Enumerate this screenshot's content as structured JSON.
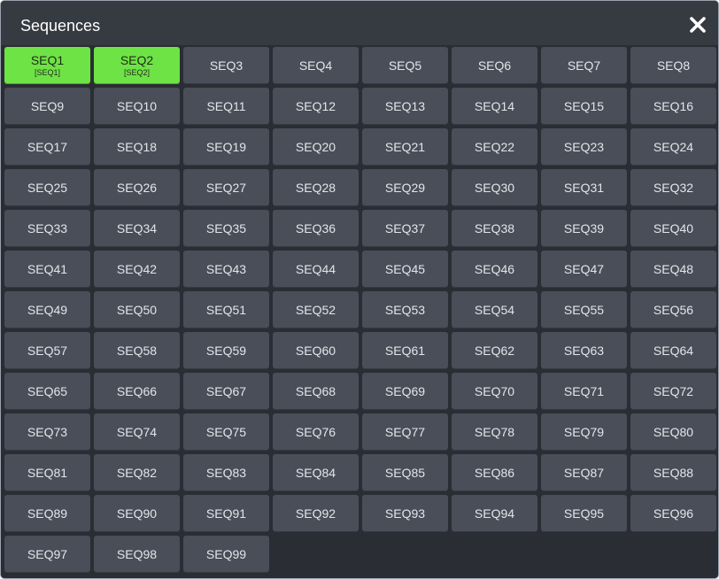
{
  "dialog": {
    "title": "Sequences"
  },
  "close_icon": "close-x-icon",
  "colors": {
    "background": "#2a2d33",
    "titlebar": "#363a41",
    "button": "#4a4e58",
    "active_button": "#6ee346",
    "button_text": "#e3e5ea"
  },
  "sequences": [
    {
      "label": "SEQ1",
      "sub": "[SEQ1]",
      "active": true
    },
    {
      "label": "SEQ2",
      "sub": "[SEQ2]",
      "active": true
    },
    {
      "label": "SEQ3"
    },
    {
      "label": "SEQ4"
    },
    {
      "label": "SEQ5"
    },
    {
      "label": "SEQ6"
    },
    {
      "label": "SEQ7"
    },
    {
      "label": "SEQ8"
    },
    {
      "label": "SEQ9"
    },
    {
      "label": "SEQ10"
    },
    {
      "label": "SEQ11"
    },
    {
      "label": "SEQ12"
    },
    {
      "label": "SEQ13"
    },
    {
      "label": "SEQ14"
    },
    {
      "label": "SEQ15"
    },
    {
      "label": "SEQ16"
    },
    {
      "label": "SEQ17"
    },
    {
      "label": "SEQ18"
    },
    {
      "label": "SEQ19"
    },
    {
      "label": "SEQ20"
    },
    {
      "label": "SEQ21"
    },
    {
      "label": "SEQ22"
    },
    {
      "label": "SEQ23"
    },
    {
      "label": "SEQ24"
    },
    {
      "label": "SEQ25"
    },
    {
      "label": "SEQ26"
    },
    {
      "label": "SEQ27"
    },
    {
      "label": "SEQ28"
    },
    {
      "label": "SEQ29"
    },
    {
      "label": "SEQ30"
    },
    {
      "label": "SEQ31"
    },
    {
      "label": "SEQ32"
    },
    {
      "label": "SEQ33"
    },
    {
      "label": "SEQ34"
    },
    {
      "label": "SEQ35"
    },
    {
      "label": "SEQ36"
    },
    {
      "label": "SEQ37"
    },
    {
      "label": "SEQ38"
    },
    {
      "label": "SEQ39"
    },
    {
      "label": "SEQ40"
    },
    {
      "label": "SEQ41"
    },
    {
      "label": "SEQ42"
    },
    {
      "label": "SEQ43"
    },
    {
      "label": "SEQ44"
    },
    {
      "label": "SEQ45"
    },
    {
      "label": "SEQ46"
    },
    {
      "label": "SEQ47"
    },
    {
      "label": "SEQ48"
    },
    {
      "label": "SEQ49"
    },
    {
      "label": "SEQ50"
    },
    {
      "label": "SEQ51"
    },
    {
      "label": "SEQ52"
    },
    {
      "label": "SEQ53"
    },
    {
      "label": "SEQ54"
    },
    {
      "label": "SEQ55"
    },
    {
      "label": "SEQ56"
    },
    {
      "label": "SEQ57"
    },
    {
      "label": "SEQ58"
    },
    {
      "label": "SEQ59"
    },
    {
      "label": "SEQ60"
    },
    {
      "label": "SEQ61"
    },
    {
      "label": "SEQ62"
    },
    {
      "label": "SEQ63"
    },
    {
      "label": "SEQ64"
    },
    {
      "label": "SEQ65"
    },
    {
      "label": "SEQ66"
    },
    {
      "label": "SEQ67"
    },
    {
      "label": "SEQ68"
    },
    {
      "label": "SEQ69"
    },
    {
      "label": "SEQ70"
    },
    {
      "label": "SEQ71"
    },
    {
      "label": "SEQ72"
    },
    {
      "label": "SEQ73"
    },
    {
      "label": "SEQ74"
    },
    {
      "label": "SEQ75"
    },
    {
      "label": "SEQ76"
    },
    {
      "label": "SEQ77"
    },
    {
      "label": "SEQ78"
    },
    {
      "label": "SEQ79"
    },
    {
      "label": "SEQ80"
    },
    {
      "label": "SEQ81"
    },
    {
      "label": "SEQ82"
    },
    {
      "label": "SEQ83"
    },
    {
      "label": "SEQ84"
    },
    {
      "label": "SEQ85"
    },
    {
      "label": "SEQ86"
    },
    {
      "label": "SEQ87"
    },
    {
      "label": "SEQ88"
    },
    {
      "label": "SEQ89"
    },
    {
      "label": "SEQ90"
    },
    {
      "label": "SEQ91"
    },
    {
      "label": "SEQ92"
    },
    {
      "label": "SEQ93"
    },
    {
      "label": "SEQ94"
    },
    {
      "label": "SEQ95"
    },
    {
      "label": "SEQ96"
    },
    {
      "label": "SEQ97"
    },
    {
      "label": "SEQ98"
    },
    {
      "label": "SEQ99"
    }
  ]
}
